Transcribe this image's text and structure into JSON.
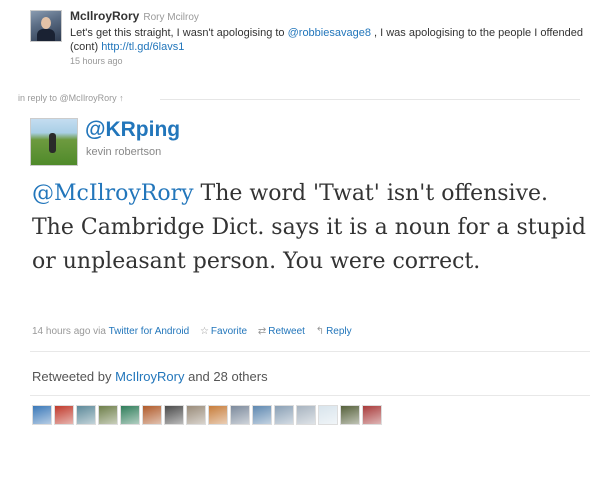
{
  "parent_tweet": {
    "screen_name": "McIlroyRory",
    "full_name": "Rory Mcilroy",
    "text_before": "Let's get this straight, I wasn't apologising to ",
    "mention": "@robbiesavage8",
    "text_after": " , I was apologising to the people I offended (cont) ",
    "link": "http://tl.gd/6lavs1",
    "time": "15 hours ago"
  },
  "in_reply_to": "in reply to @McIlroyRory ↑",
  "tweet": {
    "screen_name": "@KRping",
    "full_name": "kevin robertson",
    "mention": "@McIlroyRory",
    "text": " The word 'Twat' isn't offensive. The Cambridge Dict. says it is a noun for a stupid or unpleasant person. You were correct.",
    "time": "14 hours ago",
    "via_label": "via",
    "via_app": "Twitter for Android",
    "favorite_label": "Favorite",
    "retweet_label": "Retweet",
    "reply_label": "Reply",
    "favorite_icon": "star-icon",
    "retweet_icon": "retweet-icon",
    "reply_icon": "reply-arrow-icon"
  },
  "retweeted": {
    "prefix": "Retweeted by",
    "user": "McIlroyRory",
    "suffix": "and 28 others"
  },
  "retweeter_avatars": [
    {
      "color": "#3a78b8"
    },
    {
      "color": "#c0392b"
    },
    {
      "color": "#5d8a9a"
    },
    {
      "color": "#6e7f4a"
    },
    {
      "color": "#2f7d5a"
    },
    {
      "color": "#b05a2a"
    },
    {
      "color": "#4a4a4a"
    },
    {
      "color": "#9a8c7a"
    },
    {
      "color": "#c77d3b"
    },
    {
      "color": "#7c8a9c"
    },
    {
      "color": "#5e88b0"
    },
    {
      "color": "#8aa0b5"
    },
    {
      "color": "#a8b4c0"
    },
    {
      "color": "#d8e4ec"
    },
    {
      "color": "#55603a"
    },
    {
      "color": "#a83a3a"
    }
  ],
  "colors": {
    "link": "#2276bb",
    "muted": "#999999",
    "text": "#333333"
  }
}
